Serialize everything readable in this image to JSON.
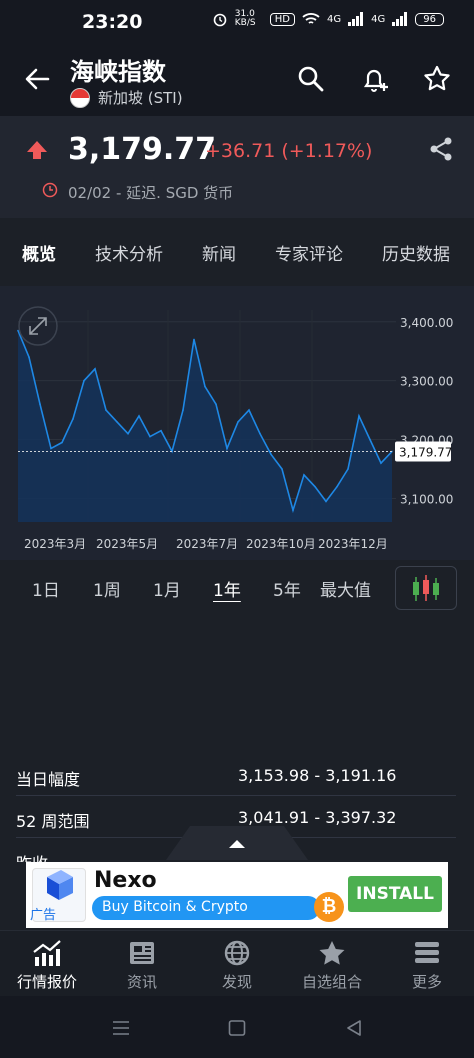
{
  "status": {
    "time": "23:20",
    "net_speed": "31.0 KB/S",
    "hd": "HD",
    "sig1": "4G",
    "sig2": "4G",
    "battery": "96"
  },
  "header": {
    "title": "海峡指数",
    "subtitle": "新加坡 (STI)",
    "icons": [
      "back-arrow-icon",
      "search-icon",
      "add-alert-icon",
      "star-icon"
    ]
  },
  "quote": {
    "price": "3,179.77",
    "change": "+36.71 (+1.17%)",
    "meta": "02/02 - 延迟. SGD 货币",
    "colors": {
      "up": "#f05a5a"
    }
  },
  "tabs": [
    {
      "label": "概览"
    },
    {
      "label": "技术分析"
    },
    {
      "label": "新闻"
    },
    {
      "label": "专家评论"
    },
    {
      "label": "历史数据"
    }
  ],
  "chart_data": {
    "type": "area",
    "x": [
      "2023-02",
      "2023-02",
      "2023-03",
      "2023-03",
      "2023-03",
      "2023-04",
      "2023-04",
      "2023-04",
      "2023-05",
      "2023-05",
      "2023-05",
      "2023-06",
      "2023-06",
      "2023-06",
      "2023-07",
      "2023-07",
      "2023-07",
      "2023-08",
      "2023-08",
      "2023-08",
      "2023-09",
      "2023-09",
      "2023-09",
      "2023-10",
      "2023-10",
      "2023-10",
      "2023-11",
      "2023-11",
      "2023-11",
      "2023-12",
      "2023-12",
      "2023-12",
      "2024-01",
      "2024-01",
      "2024-02"
    ],
    "values": [
      3385,
      3340,
      3260,
      3185,
      3195,
      3235,
      3300,
      3320,
      3250,
      3230,
      3210,
      3240,
      3205,
      3215,
      3180,
      3250,
      3370,
      3290,
      3260,
      3185,
      3230,
      3250,
      3210,
      3175,
      3150,
      3080,
      3140,
      3120,
      3095,
      3120,
      3150,
      3240,
      3200,
      3160,
      3179.77
    ],
    "current_value": "3,179.77",
    "y_ticks": [
      "3,400.00",
      "3,300.00",
      "3,200.00",
      "3,100.00"
    ],
    "x_ticks": [
      "2023年3月",
      "2023年5月",
      "2023年7月",
      "2023年10月",
      "2023年12月"
    ],
    "ylim": [
      3060,
      3420
    ],
    "colors": {
      "line": "#1e88e5",
      "fill": "#14325a"
    }
  },
  "periods": [
    {
      "label": "1日"
    },
    {
      "label": "1周"
    },
    {
      "label": "1月"
    },
    {
      "label": "1年",
      "active": true
    },
    {
      "label": "5年"
    },
    {
      "label": "最大值"
    }
  ],
  "stats": [
    {
      "label": "当日幅度",
      "value": "3,153.98 - 3,191.16"
    },
    {
      "label": "52 周范围",
      "value": "3,041.91 - 3,397.32"
    },
    {
      "label": "昨收"
    }
  ],
  "ad": {
    "title": "Nexo",
    "tagline": "Buy Bitcoin & Crypto",
    "tag": "广告",
    "cta": "INSTALL",
    "btc_symbol": "₿"
  },
  "bottom_nav": [
    {
      "label": "行情报价",
      "active": true
    },
    {
      "label": "资讯"
    },
    {
      "label": "发现"
    },
    {
      "label": "自选组合"
    },
    {
      "label": "更多"
    }
  ]
}
